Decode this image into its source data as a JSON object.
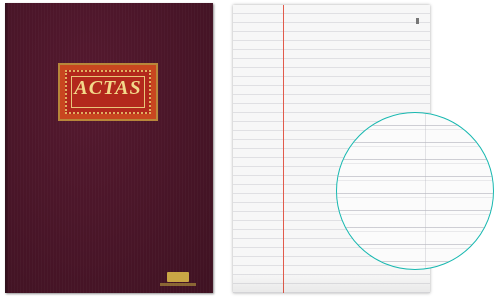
{
  "cover": {
    "title": "ACTAS",
    "colors": {
      "cover": "#4a1528",
      "label_background": "#b3281c",
      "label_border": "#b8873a",
      "title_text": "#f3d98a",
      "logo": "#c9a645"
    }
  },
  "page": {
    "colors": {
      "paper": "#f7f7f7",
      "margin_line": "#e25b4b",
      "rule_line": "#b4b4be"
    }
  },
  "magnifier": {
    "colors": {
      "outline": "#17b8b0"
    }
  }
}
